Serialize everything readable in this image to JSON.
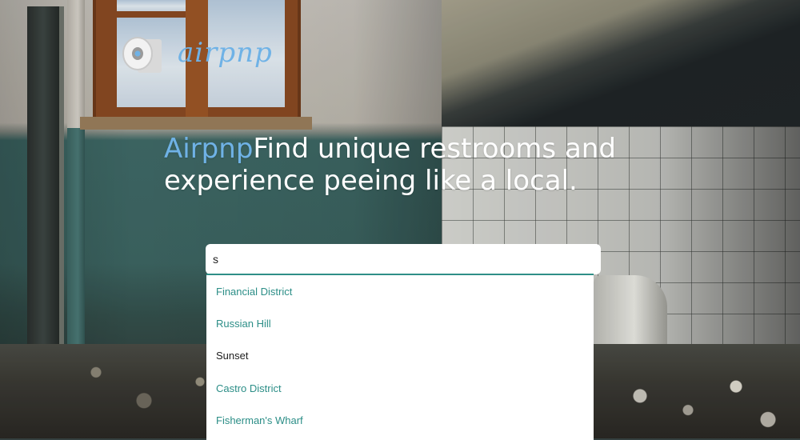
{
  "brand": {
    "logo_icon": "toilet-paper-roll-icon",
    "logo_text": "airpnp",
    "color": "#6fb2e6"
  },
  "hero": {
    "brand_word": "Airpnp",
    "tagline": "Find unique restrooms and experience peeing like a local."
  },
  "search": {
    "value": "s",
    "accent_color": "#2f8f87"
  },
  "suggestions": [
    "Financial District",
    "Russian Hill",
    "Sunset",
    "Castro District",
    "Fisherman's Wharf"
  ]
}
